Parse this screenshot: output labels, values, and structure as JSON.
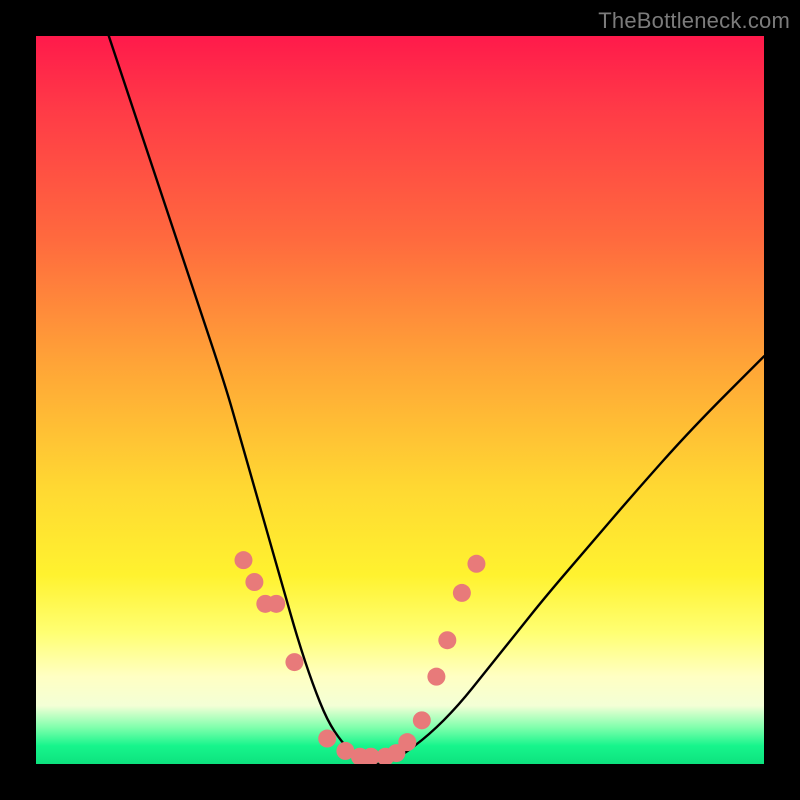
{
  "watermark": "TheBottleneck.com",
  "chart_data": {
    "type": "line",
    "title": "",
    "xlabel": "",
    "ylabel": "",
    "xlim": [
      0,
      100
    ],
    "ylim": [
      0,
      100
    ],
    "series": [
      {
        "name": "bottleneck-curve",
        "x": [
          10,
          14,
          18,
          22,
          26,
          28,
          30,
          32,
          34,
          36,
          38,
          40,
          42,
          44,
          46,
          48,
          50,
          54,
          58,
          62,
          66,
          70,
          76,
          82,
          90,
          100
        ],
        "y": [
          100,
          88,
          76,
          64,
          52,
          45,
          38,
          31,
          24,
          17,
          11,
          6,
          3,
          1,
          0,
          0,
          1,
          4,
          8,
          13,
          18,
          23,
          30,
          37,
          46,
          56
        ]
      }
    ],
    "markers": {
      "name": "highlighted-points",
      "color": "#e87a7a",
      "x": [
        28.5,
        30.0,
        31.5,
        33.0,
        35.5,
        40.0,
        42.5,
        44.5,
        46.0,
        48.0,
        49.5,
        51.0,
        53.0,
        55.0,
        56.5,
        58.5,
        60.5
      ],
      "y": [
        28.0,
        25.0,
        22.0,
        22.0,
        14.0,
        3.5,
        1.8,
        1.0,
        1.0,
        1.0,
        1.5,
        3.0,
        6.0,
        12.0,
        17.0,
        23.5,
        27.5
      ]
    },
    "background_gradient": {
      "direction": "vertical",
      "stops": [
        {
          "pos": 0.0,
          "color": "#ff1a4b"
        },
        {
          "pos": 0.45,
          "color": "#ffa437"
        },
        {
          "pos": 0.74,
          "color": "#fff22f"
        },
        {
          "pos": 0.92,
          "color": "#f3ffd6"
        },
        {
          "pos": 1.0,
          "color": "#0de27e"
        }
      ]
    }
  }
}
